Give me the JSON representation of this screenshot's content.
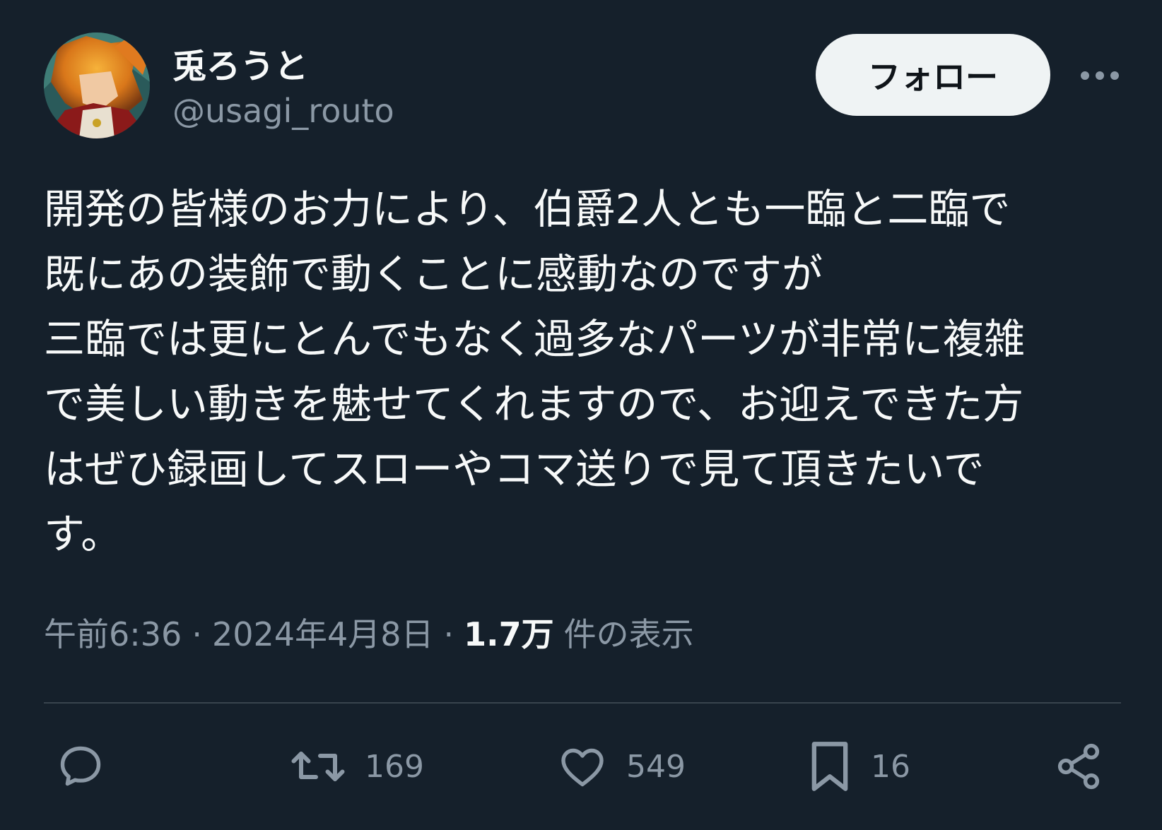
{
  "author": {
    "display_name": "兎ろうと",
    "handle": "@usagi_routo",
    "avatar_icon": "avatar-image"
  },
  "follow_label": "フォロー",
  "more_icon": "more-dots-icon",
  "tweet": {
    "text": "開発の皆様のお力により、伯爵2人とも一臨と二臨で\n既にあの装飾で動くことに感動なのですが\n三臨では更にとんでもなく過多なパーツが非常に複雑\nで美しい動きを魅せてくれますので、お迎えできた方\nはぜひ録画してスローやコマ送りで見て頂きたいで\nす。"
  },
  "meta": {
    "time": "午前6:36",
    "separator": "·",
    "date": "2024年4月8日",
    "views_count": "1.7万",
    "views_label": "件の表示"
  },
  "actions": {
    "reply_icon": "reply-icon",
    "retweet_icon": "retweet-icon",
    "retweets": "169",
    "like_icon": "heart-icon",
    "likes": "549",
    "bookmark_icon": "bookmark-icon",
    "bookmarks": "16",
    "share_icon": "share-icon"
  },
  "colors": {
    "background": "#15202b",
    "text_primary": "#f7f9f9",
    "text_secondary": "#8b98a5",
    "divider": "#38444d",
    "follow_button_bg": "#eff3f4"
  }
}
